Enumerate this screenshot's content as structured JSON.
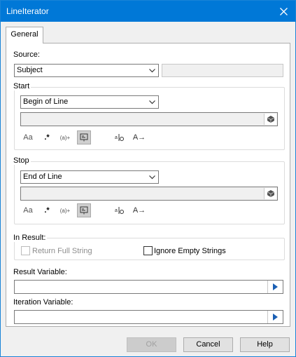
{
  "window": {
    "title": "LineIterator"
  },
  "tabs": [
    {
      "label": "General"
    }
  ],
  "source": {
    "label": "Source:",
    "selected": "Subject",
    "extra_value": ""
  },
  "start": {
    "title": "Start",
    "selected": "Begin of Line",
    "pattern": "",
    "tools": [
      "Aa",
      ".*",
      "(a)+",
      "",
      "",
      "A→"
    ]
  },
  "stop": {
    "title": "Stop",
    "selected": "End of Line",
    "pattern": "",
    "tools": [
      "Aa",
      ".*",
      "(a)+",
      "",
      "",
      "A→"
    ]
  },
  "in_result": {
    "title": "In Result:",
    "return_full_string": {
      "label": "Return Full String",
      "checked": false,
      "enabled": false
    },
    "ignore_empty_strings": {
      "label": "Ignore Empty Strings",
      "checked": false,
      "enabled": true
    }
  },
  "result_variable": {
    "label": "Result Variable:",
    "value": ""
  },
  "iteration_variable": {
    "label": "Iteration Variable:",
    "value": ""
  },
  "buttons": {
    "ok": "OK",
    "cancel": "Cancel",
    "help": "Help"
  }
}
